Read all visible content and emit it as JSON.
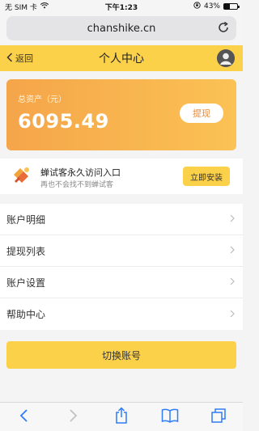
{
  "status_bar": {
    "carrier": "无 SIM 卡",
    "time": "下午1:23",
    "battery": "43%",
    "battery_level": 0.43
  },
  "browser": {
    "url": "chanshike.cn"
  },
  "header": {
    "back_label": "返回",
    "title": "个人中心"
  },
  "asset": {
    "label": "总资产（元）",
    "value": "6095.49",
    "withdraw_label": "提现"
  },
  "promo": {
    "title": "蝉试客永久访问入口",
    "subtitle": "再也不会找不到蝉试客",
    "install_label": "立即安装"
  },
  "menu": {
    "items": [
      {
        "label": "账户明细"
      },
      {
        "label": "提现列表"
      },
      {
        "label": "账户设置"
      },
      {
        "label": "帮助中心"
      }
    ]
  },
  "actions": {
    "switch_account_label": "切换账号"
  },
  "colors": {
    "accent": "#fcd14a",
    "card_start": "#f5a54a",
    "card_end": "#fbc254"
  }
}
